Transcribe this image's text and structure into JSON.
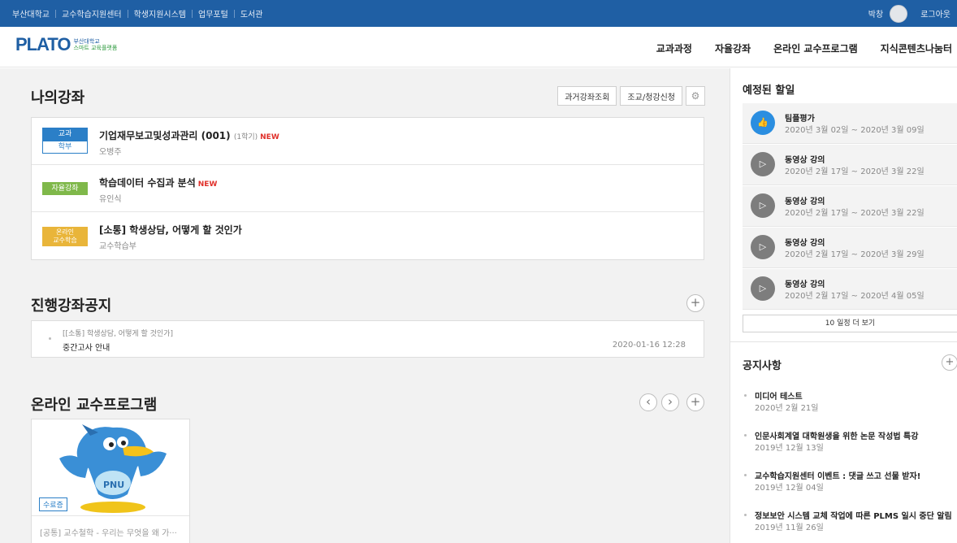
{
  "topbar": {
    "links": [
      "부산대학교",
      "교수학습지원센터",
      "학생지원시스템",
      "업무포털",
      "도서관"
    ],
    "user_name": "박창",
    "logout": "로그아웃"
  },
  "header": {
    "logo": "PLATO",
    "logo_sub1": "부산대학교",
    "logo_sub2": "스마트 교육플랫폼",
    "nav": [
      "교과과정",
      "자율강좌",
      "온라인 교수프로그램",
      "지식콘텐츠나눔터"
    ]
  },
  "my_courses": {
    "title": "나의강좌",
    "buttons": {
      "past": "과거강좌조회",
      "assist": "조교/청강신청"
    },
    "items": [
      {
        "badge_top": "교과",
        "badge_bottom": "학부",
        "title": "기업재무보고및성과관리 (001)",
        "semester": "(1학기)",
        "new": "NEW",
        "professor": "오병주"
      },
      {
        "badge_top": "자율강좌",
        "title": "학습데이터 수집과 분석",
        "new": "NEW",
        "professor": "유인식"
      },
      {
        "badge_top": "온라인",
        "badge_bottom": "교수학습",
        "title": "[소통] 학생상담, 어떻게 할 것인가",
        "professor": "교수학습부"
      }
    ]
  },
  "course_notice": {
    "title": "진행강좌공지",
    "item": {
      "course": "[[소통] 학생상담, 어떻게 할 것인가]",
      "title": "중간고사 안내",
      "date": "2020-01-16 12:28"
    }
  },
  "online_program": {
    "title": "온라인 교수프로그램",
    "card": {
      "cert": "수료증",
      "title": "[공통] 교수철학 - 우리는 무엇을 왜 가···",
      "mascot_text": "PNU"
    }
  },
  "todo": {
    "title": "예정된 할일",
    "items": [
      {
        "type": "팀플평가",
        "period": "2020년 3월 02일 ~ 2020년 3월 09일"
      },
      {
        "type": "동영상 강의",
        "period": "2020년 2월 17일 ~ 2020년 3월 22일"
      },
      {
        "type": "동영상 강의",
        "period": "2020년 2월 17일 ~ 2020년 3월 22일"
      },
      {
        "type": "동영상 강의",
        "period": "2020년 2월 17일 ~ 2020년 3월 29일"
      },
      {
        "type": "동영상 강의",
        "period": "2020년 2월 17일 ~ 2020년 4월 05일"
      }
    ],
    "more": "10 일정 더 보기"
  },
  "notices": {
    "title": "공지사항",
    "items": [
      {
        "title": "미디어 테스트",
        "date": "2020년 2월 21일"
      },
      {
        "title": "인문사회계열 대학원생을 위한 논문 작성법 특강",
        "date": "2019년 12월 13일"
      },
      {
        "title": "교수학습지원센터 이벤트 : 댓글 쓰고 선물 받자!",
        "date": "2019년 12월 04일"
      },
      {
        "title": "정보보안 시스템 교체 작업에 따른 PLMS 일시 중단 알림",
        "date": "2019년 11월 26일"
      }
    ]
  }
}
